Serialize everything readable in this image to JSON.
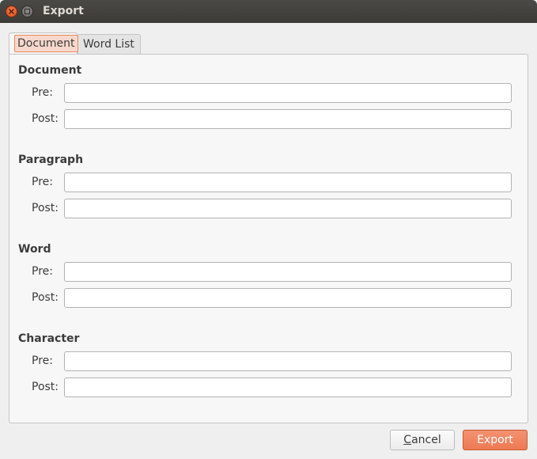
{
  "window": {
    "title": "Export"
  },
  "tabs": [
    {
      "label": "Document",
      "active": true
    },
    {
      "label": "Word List",
      "active": false
    }
  ],
  "sections": [
    {
      "title": "Document",
      "pre_label": "Pre:",
      "post_label": "Post:",
      "pre_value": "",
      "post_value": ""
    },
    {
      "title": "Paragraph",
      "pre_label": "Pre:",
      "post_label": "Post:",
      "pre_value": "",
      "post_value": ""
    },
    {
      "title": "Word",
      "pre_label": "Pre:",
      "post_label": "Post:",
      "pre_value": "",
      "post_value": ""
    },
    {
      "title": "Character",
      "pre_label": "Pre:",
      "post_label": "Post:",
      "pre_value": "",
      "post_value": ""
    }
  ],
  "buttons": {
    "cancel_mnemonic": "C",
    "cancel_rest": "ancel",
    "export": "Export"
  },
  "colors": {
    "accent": "#ee7a52",
    "titlebar": "#3c3b37"
  }
}
